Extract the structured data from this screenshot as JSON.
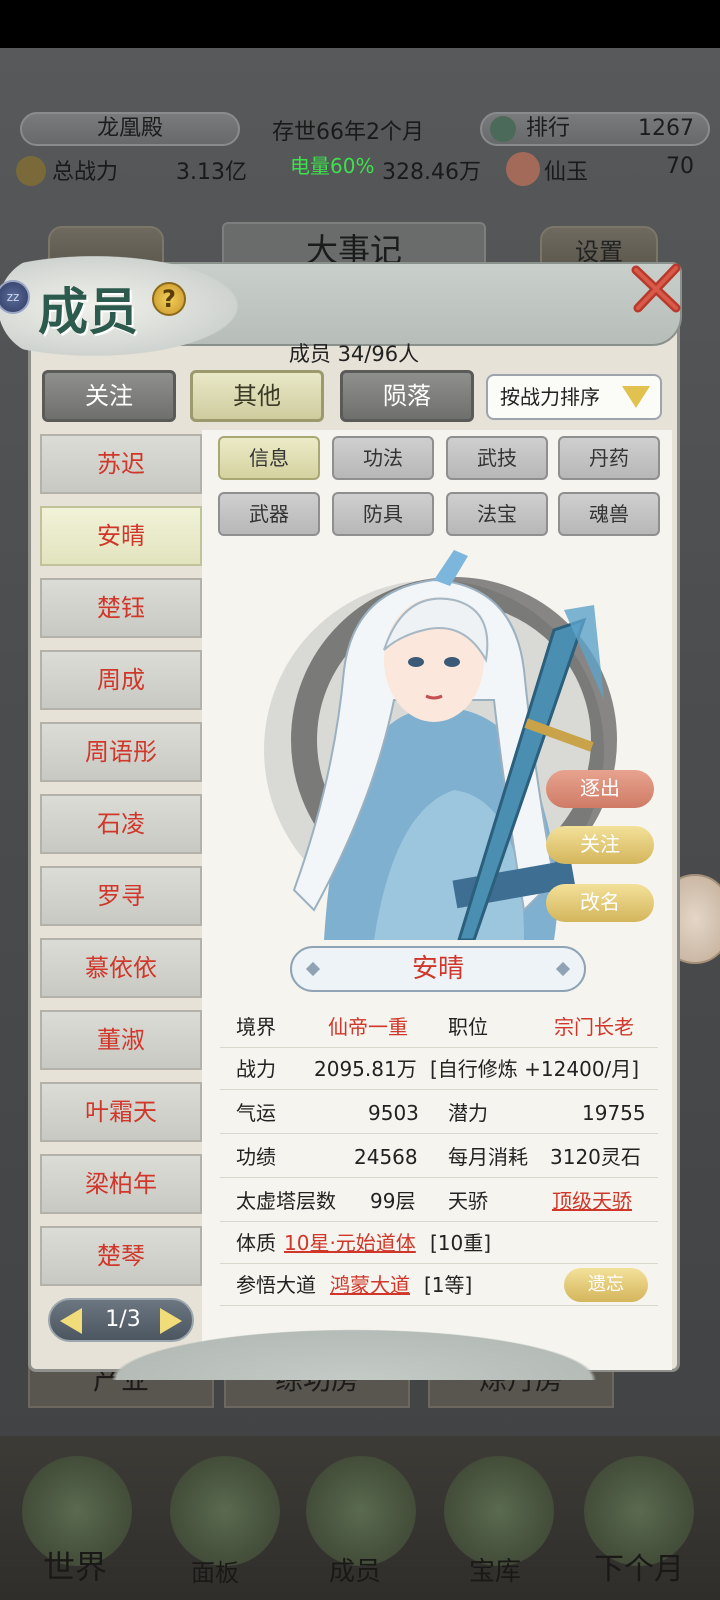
{
  "background": {
    "location": "龙凰殿",
    "age": "存世66年2个月",
    "rank_label": "排行",
    "rank_value": "1267",
    "power_label": "总战力",
    "power_value": "3.13亿",
    "battery": "电量60%",
    "spirit_value": "328.46万",
    "jade_label": "仙玉",
    "jade_value": "70",
    "center_title": "大事记",
    "settings_label": "设置",
    "lower_buttons": [
      "产业",
      "练功房",
      "炼丹房"
    ],
    "nav": [
      "世界",
      "面板",
      "成员",
      "宝库",
      "下个月"
    ]
  },
  "modal": {
    "title": "成员",
    "help": "?",
    "member_count": "成员  34/96人",
    "tabs": [
      "关注",
      "其他",
      "陨落"
    ],
    "active_tab": "其他",
    "sort_label": "按战力排序",
    "members": [
      "苏迟",
      "安晴",
      "楚钰",
      "周成",
      "周语彤",
      "石凌",
      "罗寻",
      "慕依依",
      "董淑",
      "叶霜天",
      "梁柏年",
      "楚琴"
    ],
    "selected_member": "安晴",
    "sub_tabs": [
      "信息",
      "功法",
      "武技",
      "丹药",
      "武器",
      "防具",
      "法宝",
      "魂兽"
    ],
    "actions": {
      "expel": "逐出",
      "follow": "关注",
      "rename": "改名"
    },
    "name": "安晴",
    "info": {
      "realm_label": "境界",
      "realm": "仙帝一重",
      "position_label": "职位",
      "position": "宗门长老",
      "power_label": "战力",
      "power": "2095.81万",
      "training": "[自行修炼 +12400/月]",
      "luck_label": "气运",
      "luck": "9503",
      "potential_label": "潜力",
      "potential": "19755",
      "merit_label": "功绩",
      "merit": "24568",
      "monthly_cost_label": "每月消耗",
      "monthly_cost": "3120灵石",
      "tower_label": "太虚塔层数",
      "tower": "99层",
      "prodigy_label": "天骄",
      "prodigy": "顶级天骄",
      "physique_label": "体质",
      "physique": "10星·元始道体",
      "physique_level": "[10重]",
      "dao_label": "参悟大道",
      "dao": "鸿蒙大道",
      "dao_level": "[1等]",
      "forget_label": "遗忘"
    },
    "pager": "1/3"
  }
}
